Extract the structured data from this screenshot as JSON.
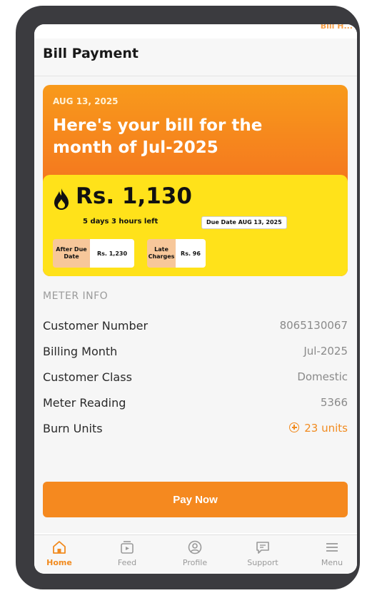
{
  "header": {
    "title": "Bill Payment",
    "top_strip_text": "Bill H..."
  },
  "bill": {
    "date": "AUG 13, 2025",
    "headline": "Here's your bill for the month of Jul-2025",
    "amount": "Rs. 1,130",
    "time_left": "5 days 3 hours left",
    "due_chip": "Due Date AUG 13, 2025",
    "after_due": {
      "label": "After Due Date",
      "value": "Rs. 1,230"
    },
    "late_charges": {
      "label": "Late Charges",
      "value": "Rs. 96"
    }
  },
  "meter_info": {
    "title": "METER INFO",
    "rows": [
      {
        "label": "Customer Number",
        "value": "8065130067"
      },
      {
        "label": "Billing Month",
        "value": "Jul-2025"
      },
      {
        "label": "Customer Class",
        "value": "Domestic"
      },
      {
        "label": "Meter Reading",
        "value": "5366"
      },
      {
        "label": "Burn Units",
        "value": "23 units"
      }
    ]
  },
  "pay_button": "Pay Now",
  "nav": [
    {
      "label": "Home",
      "icon": "home-icon",
      "active": true
    },
    {
      "label": "Feed",
      "icon": "feed-icon"
    },
    {
      "label": "Profile",
      "icon": "profile-icon"
    },
    {
      "label": "Support",
      "icon": "support-icon"
    },
    {
      "label": "Menu",
      "icon": "menu-icon"
    }
  ],
  "colors": {
    "accent": "#f5891f",
    "banner_yellow": "#ffe21a",
    "frame": "#3b3b3f"
  }
}
